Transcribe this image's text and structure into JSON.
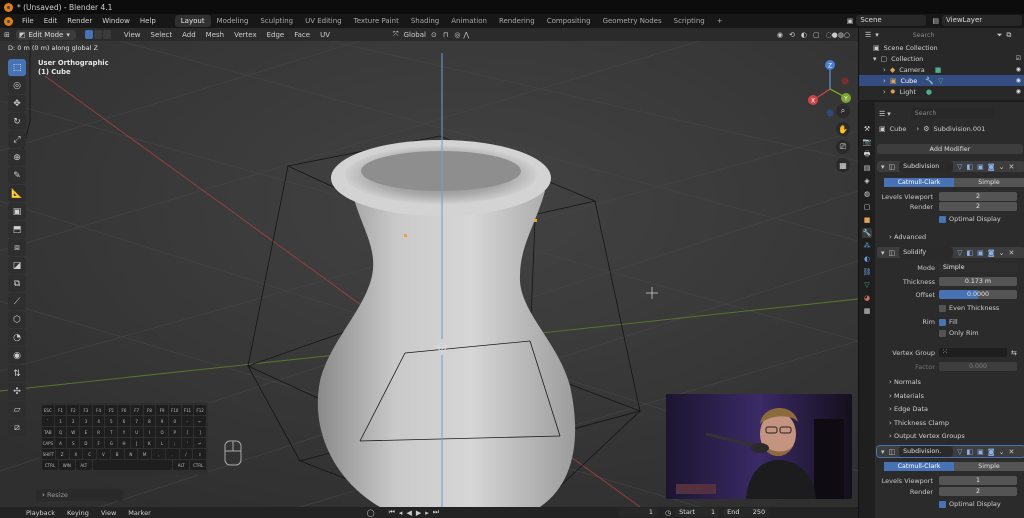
{
  "window": {
    "title": "* (Unsaved) - Blender 4.1"
  },
  "menu": {
    "items": [
      "File",
      "Edit",
      "Render",
      "Window",
      "Help"
    ],
    "workspaces": [
      "Layout",
      "Modeling",
      "Sculpting",
      "UV Editing",
      "Texture Paint",
      "Shading",
      "Animation",
      "Rendering",
      "Compositing",
      "Geometry Nodes",
      "Scripting"
    ],
    "active_workspace": "Layout",
    "add_tab": "+",
    "scene": "Scene",
    "view_layer": "ViewLayer"
  },
  "viewport_header": {
    "mode": "Edit Mode",
    "menus": [
      "View",
      "Select",
      "Add",
      "Mesh",
      "Vertex",
      "Edge",
      "Face",
      "UV"
    ],
    "orientation": "Global"
  },
  "viewport": {
    "status_text": "D: 0 m (0 m) along global Z",
    "view_name": "User Orthographic",
    "object_name": "(1) Cube",
    "resize_label": "Resize",
    "gizmo_labels": {
      "x": "X",
      "y": "Y",
      "z": "Z"
    }
  },
  "toolbar": {
    "tools": [
      "select-box-icon",
      "cursor-icon",
      "move-icon",
      "rotate-icon",
      "scale-icon",
      "transform-icon",
      "annotate-icon",
      "measure-icon",
      "add-cube-icon",
      "extrude-icon",
      "inset-icon",
      "bevel-icon",
      "loop-cut-icon",
      "knife-icon",
      "poly-build-icon",
      "spin-icon",
      "smooth-icon",
      "edge-slide-icon",
      "shrink-fatten-icon",
      "shear-icon",
      "rip-icon"
    ]
  },
  "keyboard_overlay": {
    "rows": [
      [
        "ESC",
        "F1",
        "F2",
        "F3",
        "F4",
        "F5",
        "F6",
        "F7",
        "F8",
        "F9",
        "F10",
        "F11",
        "F12"
      ],
      [
        "`",
        "1",
        "2",
        "3",
        "4",
        "5",
        "6",
        "7",
        "8",
        "9",
        "0",
        "-",
        "←"
      ],
      [
        "TAB",
        "Q",
        "W",
        "E",
        "R",
        "T",
        "Y",
        "U",
        "I",
        "O",
        "P",
        "[",
        "]"
      ],
      [
        "CAPS",
        "A",
        "S",
        "D",
        "F",
        "G",
        "H",
        "J",
        "K",
        "L",
        ";",
        "'",
        "↵"
      ],
      [
        "SHIFT",
        "Z",
        "X",
        "C",
        "V",
        "B",
        "N",
        "M",
        ",",
        ".",
        "/",
        "⇧"
      ],
      [
        "CTRL",
        "WIN",
        "ALT",
        "",
        "ALT",
        "CTRL"
      ]
    ]
  },
  "timeline": {
    "menus": [
      "Playback",
      "Keying",
      "View",
      "Marker"
    ],
    "current_frame": "1",
    "start_label": "Start",
    "start": "1",
    "end_label": "End",
    "end": "250"
  },
  "outliner": {
    "search_placeholder": "Search",
    "root": "Scene Collection",
    "collection": "Collection",
    "items": [
      {
        "name": "Camera",
        "selected": false
      },
      {
        "name": "Cube",
        "selected": true
      },
      {
        "name": "Light",
        "selected": false
      }
    ]
  },
  "properties": {
    "search_placeholder": "Search",
    "breadcrumb_object": "Cube",
    "breadcrumb_modifier": "Subdivision.001",
    "add_modifier": "Add Modifier",
    "mod1": {
      "name": "Subdivision",
      "tabs": [
        "Catmull-Clark",
        "Simple"
      ],
      "levels_label": "Levels Viewport",
      "levels": "2",
      "render_label": "Render",
      "render": "2",
      "optimal": "Optimal Display",
      "advanced": "Advanced"
    },
    "mod2": {
      "name": "Solidify",
      "mode_label": "Mode",
      "mode": "Simple",
      "thickness_label": "Thickness",
      "thickness": "0.173 m",
      "offset_label": "Offset",
      "offset": "0.0000",
      "offset_fraction": 0.5,
      "even": "Even Thickness",
      "rim_label": "Rim",
      "fill": "Fill",
      "only_rim": "Only Rim",
      "vgroup_label": "Vertex Group",
      "factor_label": "Factor",
      "factor": "0.000",
      "panels": [
        "Normals",
        "Materials",
        "Edge Data",
        "Thickness Clamp",
        "Output Vertex Groups"
      ]
    },
    "mod3": {
      "name": "Subdivision.",
      "tabs": [
        "Catmull-Clark",
        "Simple"
      ],
      "levels_label": "Levels Viewport",
      "levels": "1",
      "render_label": "Render",
      "render": "2",
      "optimal": "Optimal Display"
    }
  },
  "colors": {
    "accent": "#4772b3",
    "viewport_bg": "#3a3a3a",
    "panel_bg": "#2b2b2b"
  }
}
